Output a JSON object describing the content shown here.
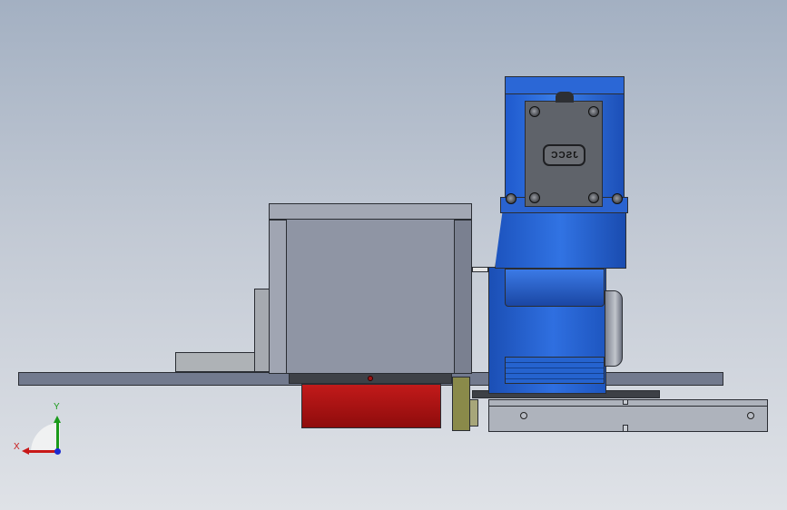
{
  "motor": {
    "brand_label": "JSCC"
  },
  "triad": {
    "x_label": "X",
    "y_label": "Y"
  },
  "colors": {
    "background_top": "#a3b0c2",
    "background_bottom": "#dfe2e7",
    "motor_blue": "#1f5fd0",
    "housing_gray": "#8f95a4",
    "roller_red": "#b01010",
    "bracket_olive": "#8a8a4a"
  }
}
